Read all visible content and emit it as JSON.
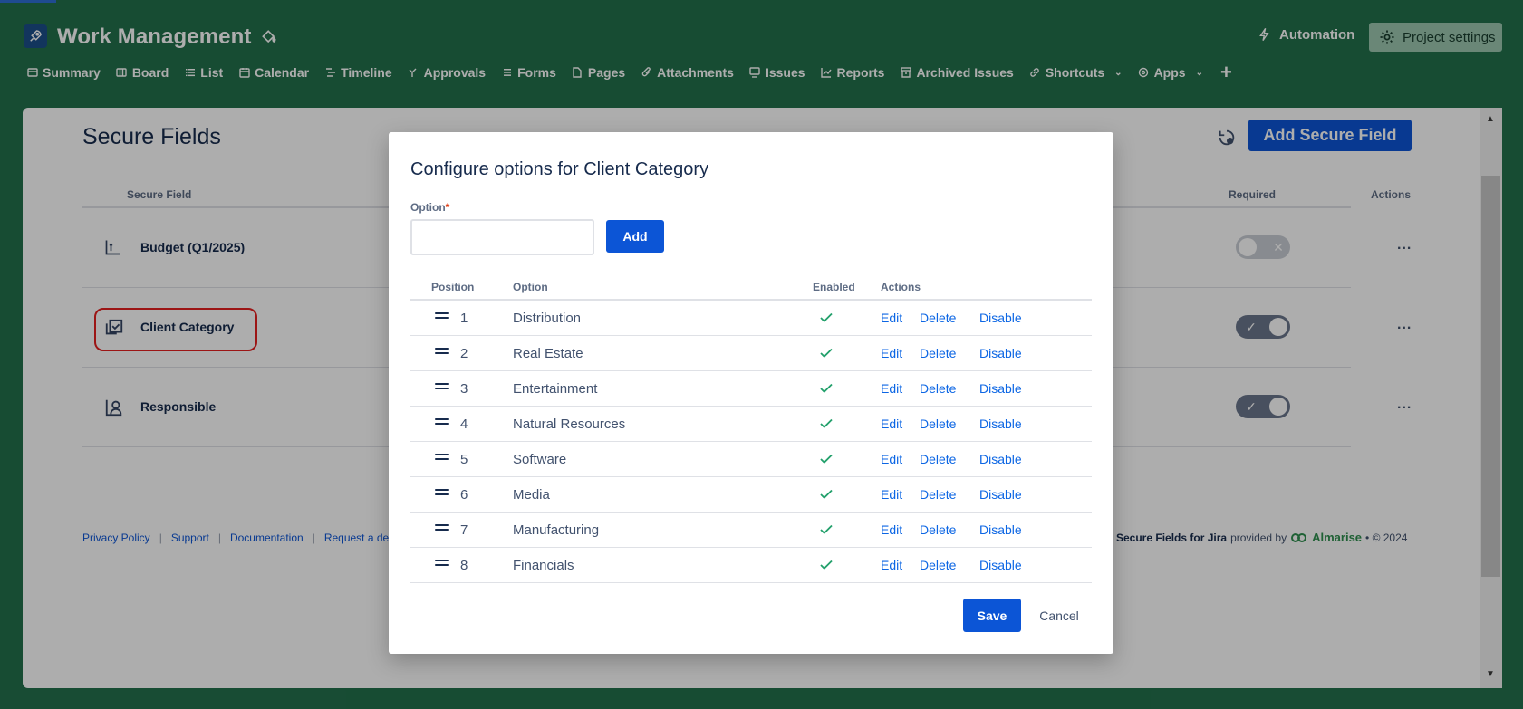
{
  "header": {
    "project_title": "Work Management",
    "automation_label": "Automation",
    "project_settings_label": "Project settings",
    "tabs": [
      {
        "label": "Summary",
        "icon": "summary-icon"
      },
      {
        "label": "Board",
        "icon": "board-icon"
      },
      {
        "label": "List",
        "icon": "list-icon"
      },
      {
        "label": "Calendar",
        "icon": "calendar-icon"
      },
      {
        "label": "Timeline",
        "icon": "timeline-icon"
      },
      {
        "label": "Approvals",
        "icon": "approvals-icon"
      },
      {
        "label": "Forms",
        "icon": "forms-icon"
      },
      {
        "label": "Pages",
        "icon": "pages-icon"
      },
      {
        "label": "Attachments",
        "icon": "attachment-icon"
      },
      {
        "label": "Issues",
        "icon": "issues-icon"
      },
      {
        "label": "Reports",
        "icon": "reports-icon"
      },
      {
        "label": "Archived Issues",
        "icon": "archive-icon"
      },
      {
        "label": "Shortcuts",
        "icon": "link-icon"
      },
      {
        "label": "Apps",
        "icon": "apps-icon"
      }
    ]
  },
  "page": {
    "title": "Secure Fields",
    "add_button_label": "Add Secure Field",
    "columns": {
      "field": "Secure Field",
      "required": "Required",
      "actions": "Actions"
    },
    "rows": [
      {
        "name": "Budget (Q1/2025)",
        "icon": "budget-icon",
        "required": false
      },
      {
        "name": "Client Category",
        "icon": "category-icon",
        "required": true
      },
      {
        "name": "Responsible",
        "icon": "person-icon",
        "required": true
      }
    ],
    "actions_menu": "...",
    "footer_links": [
      "Privacy Policy",
      "Support",
      "Documentation",
      "Request a de"
    ],
    "footer_product": "Secure Fields for Jira",
    "footer_provided_by": "provided by",
    "footer_brand": "Almarise",
    "footer_copyright": "• © 2024"
  },
  "modal": {
    "title": "Configure options for Client Category",
    "option_label": "Option",
    "required_marker": "*",
    "option_input_value": "",
    "add_label": "Add",
    "columns": {
      "position": "Position",
      "option": "Option",
      "enabled": "Enabled",
      "actions": "Actions"
    },
    "rows": [
      {
        "position": "1",
        "option": "Distribution",
        "enabled": true
      },
      {
        "position": "2",
        "option": "Real Estate",
        "enabled": true
      },
      {
        "position": "3",
        "option": "Entertainment",
        "enabled": true
      },
      {
        "position": "4",
        "option": "Natural Resources",
        "enabled": true
      },
      {
        "position": "5",
        "option": "Software",
        "enabled": true
      },
      {
        "position": "6",
        "option": "Media",
        "enabled": true
      },
      {
        "position": "7",
        "option": "Manufacturing",
        "enabled": true
      },
      {
        "position": "8",
        "option": "Financials",
        "enabled": true
      }
    ],
    "row_actions": {
      "edit": "Edit",
      "delete": "Delete",
      "disable": "Disable"
    },
    "save_label": "Save",
    "cancel_label": "Cancel"
  },
  "colors": {
    "header_bg": "#23704c",
    "primary": "#0c55d6",
    "link": "#0c66e4",
    "check": "#22a06b",
    "highlight": "#e61f1f"
  }
}
